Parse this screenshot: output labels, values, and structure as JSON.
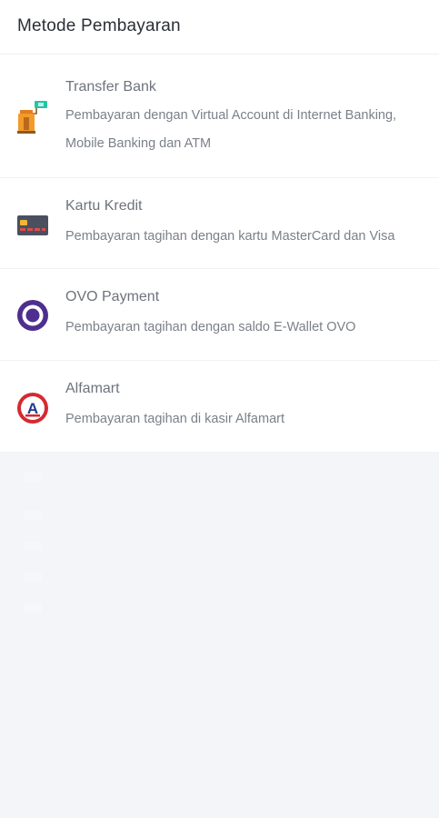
{
  "header": {
    "title": "Metode Pembayaran"
  },
  "methods": [
    {
      "title": "Transfer Bank",
      "desc": "Pembayaran dengan Virtual Account di Internet Banking, Mobile Banking dan ATM",
      "icon": "bank-transfer-icon"
    },
    {
      "title": "Kartu Kredit",
      "desc": "Pembayaran tagihan dengan kartu MasterCard dan Visa",
      "icon": "credit-card-icon"
    },
    {
      "title": "OVO Payment",
      "desc": "Pembayaran tagihan dengan saldo E-Wallet OVO",
      "icon": "ovo-icon"
    },
    {
      "title": "Alfamart",
      "desc": "Pembayaran tagihan di kasir Alfamart",
      "icon": "alfamart-icon"
    }
  ],
  "colors": {
    "background": "#f4f5f8",
    "ovo": "#4e2f8f",
    "alfamart_red": "#d42a30",
    "alfamart_blue": "#1f3b8a",
    "bank_orange": "#f39a2b",
    "bank_teal": "#23c6a4",
    "card": "#4a5060",
    "card_chip": "#f2b632"
  }
}
